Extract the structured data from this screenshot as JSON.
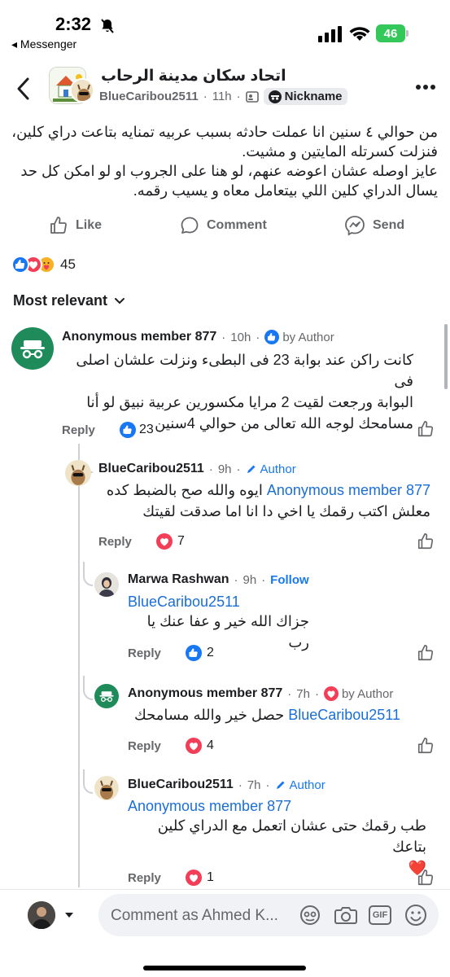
{
  "status_bar": {
    "time": "2:32",
    "back_app": "◂ Messenger",
    "battery": "46"
  },
  "header": {
    "group_name": "اتحاد سكان مدينة الرحاب",
    "author": "BlueCaribou2511",
    "time": "11h",
    "nickname_label": "Nickname"
  },
  "post": {
    "text_line1": "من حوالي ٤ سنين انا عملت حادثه بسبب عربيه تمنايه بتاعت دراي كلين،",
    "text_line2": "فنزلت كسرتله المايتين و مشيت.",
    "text_line3": "عايز اوصله عشان اعوضه عنهم، لو هنا على الجروب او لو امكن كل حد",
    "text_line4": "يسال الدراي كلين اللي بيتعامل معاه و يسيب رقمه."
  },
  "actions": {
    "like": "Like",
    "comment": "Comment",
    "send": "Send"
  },
  "reactions": {
    "count": "45"
  },
  "sort": {
    "label": "Most relevant"
  },
  "comments": [
    {
      "name": "Anonymous member 877",
      "time": "10h",
      "badge": "by Author",
      "line1": "كانت راكن عند بوابة 23 فى البطىء ونزلت علشان اصلى فى",
      "line2": "البوابة ورجعت لقيت 2 مرايا مكسورين عربية نبيق لو أنا",
      "line3": "مسامحك لوجه الله تعالى من حوالي 4سنين",
      "reply": "Reply",
      "reaction_count": "23"
    },
    {
      "name": "BlueCaribou2511",
      "time": "9h",
      "badge": "Author",
      "mention": "Anonymous member 877",
      "line1": "ايوه والله صح بالضبط كده",
      "line2": "معلش اكتب رقمك يا اخي دا انا اما صدقت لقيتك",
      "reply": "Reply",
      "reaction_count": "7"
    },
    {
      "name": "Marwa Rashwan",
      "time": "9h",
      "follow": "Follow",
      "mention": "BlueCaribou2511",
      "line1": "جزاك الله خير و عفا عنك يا رب",
      "reply": "Reply",
      "reaction_count": "2"
    },
    {
      "name": "Anonymous member 877",
      "time": "7h",
      "badge": "by Author",
      "mention": "BlueCaribou2511",
      "line1": "حصل خير والله مسامحك",
      "reply": "Reply",
      "reaction_count": "4"
    },
    {
      "name": "BlueCaribou2511",
      "time": "7h",
      "badge": "Author",
      "mention": "Anonymous member 877",
      "line1": "طب رقمك حتى عشان اتعمل مع الدراي كلين بتاعك",
      "line2": "❤️",
      "reply": "Reply",
      "reaction_count": "1"
    }
  ],
  "composer": {
    "placeholder": "Comment as Ahmed K..."
  },
  "colors": {
    "facebook_blue": "#1877f2",
    "love_red": "#f33e58",
    "text_secondary": "#65676b"
  }
}
